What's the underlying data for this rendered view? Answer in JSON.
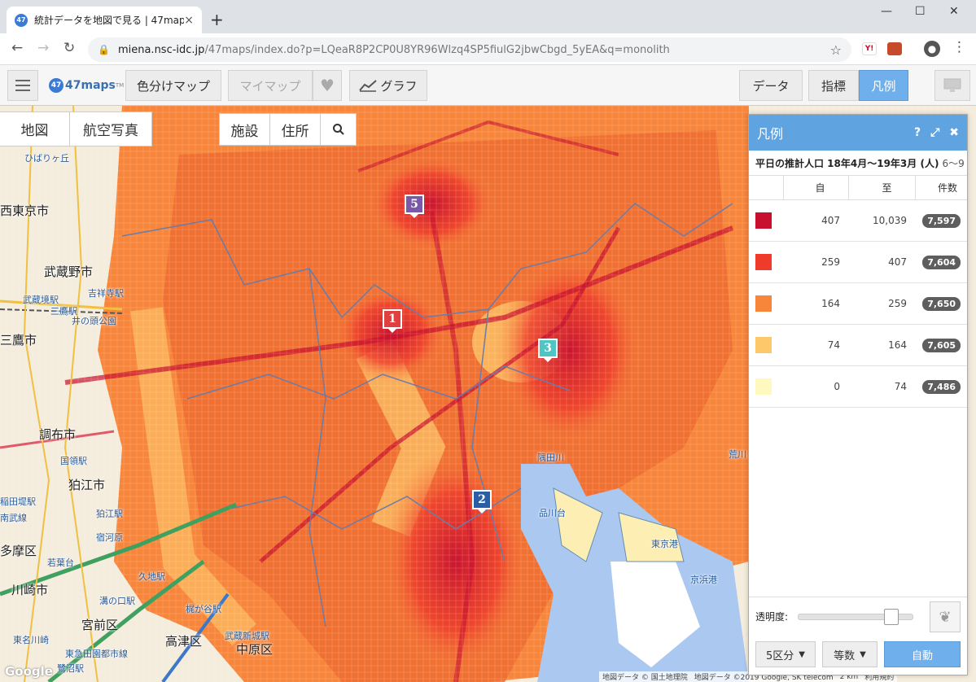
{
  "browser": {
    "tab_title": "統計データを地図で見る | 47maps",
    "favicon_text": "47",
    "new_tab": "+",
    "tab_close": "×",
    "url_host": "miena.nsc-idc.jp",
    "url_path": "/47maps/index.do?p=LQeaR8P2CP0U8YR96Wlzq4SP5fiulG2jbwCbgd_5yEA&q=monolith",
    "ext_yahoo": "Y!"
  },
  "toolbar": {
    "logo_badge": "47",
    "logo_text": "47maps",
    "logo_tm": "TM",
    "color_map": "色分けマップ",
    "my_map": "マイマップ",
    "graph": "グラフ",
    "data": "データ",
    "indicator": "指標",
    "legend": "凡例"
  },
  "map": {
    "btn_map": "地図",
    "btn_aerial": "航空写真",
    "btn_facility": "施設",
    "btn_address": "住所",
    "markers": [
      {
        "label": "1",
        "color": "#e04040"
      },
      {
        "label": "2",
        "color": "#2a5fa8"
      },
      {
        "label": "3",
        "color": "#4fc6c4"
      },
      {
        "label": "5",
        "color": "#7a5aa8"
      }
    ],
    "labels": {
      "nishitokyo": "西東京市",
      "musashino": "武蔵野市",
      "mitaka": "三鷹市",
      "chofu": "調布市",
      "komae": "狛江市",
      "tama": "多摩区",
      "kawasaki": "川崎市",
      "miyamae": "宮前区",
      "takatsu": "高津区",
      "nakahara": "中原区",
      "kichijoji": "吉祥寺駅",
      "musashisakai": "武蔵境駅",
      "mitakast": "三鷹駅",
      "inokashira": "井の頭公園",
      "kokuryo": "国領駅",
      "komaest": "狛江駅",
      "tokyoport": "東京港",
      "keihin": "京浜港",
      "shinagawa": "品川台",
      "sumida": "隅田川",
      "ara": "荒川",
      "hibari": "ひばりヶ丘",
      "wakaba": "若葉台",
      "inada": "稲田堤駅",
      "nanbu": "南武線",
      "shukugawara": "宿河原",
      "mizonokuchi": "溝の口駅",
      "musashikosugi": "武蔵新城駅",
      "toyoko": "東急田園都市線",
      "saginuma": "鷺沼駅",
      "kuzi": "久地駅",
      "kajigaya": "梶が谷駅",
      "tomei": "東名川崎"
    },
    "attribution_1": "地図データ © 国土地理院",
    "attribution_2": "地図データ ©2019 Google, SK telecom",
    "scale": "2 km",
    "terms": "利用規約",
    "google": "Google"
  },
  "legend": {
    "title": "凡例",
    "help": "?",
    "expand": "⤢",
    "close": "✖",
    "subtitle": "平日の推計人口 18年4月〜19年3月 (人)",
    "subtitle_rest": "6〜9",
    "columns": [
      "",
      "自",
      "至",
      "件数"
    ],
    "rows": [
      {
        "color": "#c8102e",
        "from": "407",
        "to": "10,039",
        "count": "7,597"
      },
      {
        "color": "#ee3b2a",
        "from": "259",
        "to": "407",
        "count": "7,604"
      },
      {
        "color": "#f7853a",
        "from": "164",
        "to": "259",
        "count": "7,650"
      },
      {
        "color": "#fdc86a",
        "from": "74",
        "to": "164",
        "count": "7,605"
      },
      {
        "color": "#fff8bf",
        "from": "0",
        "to": "74",
        "count": "7,486"
      }
    ],
    "opacity_label": "透明度:",
    "opacity_value": 0.75,
    "classes": "5区分",
    "method": "等数",
    "auto": "自動"
  }
}
